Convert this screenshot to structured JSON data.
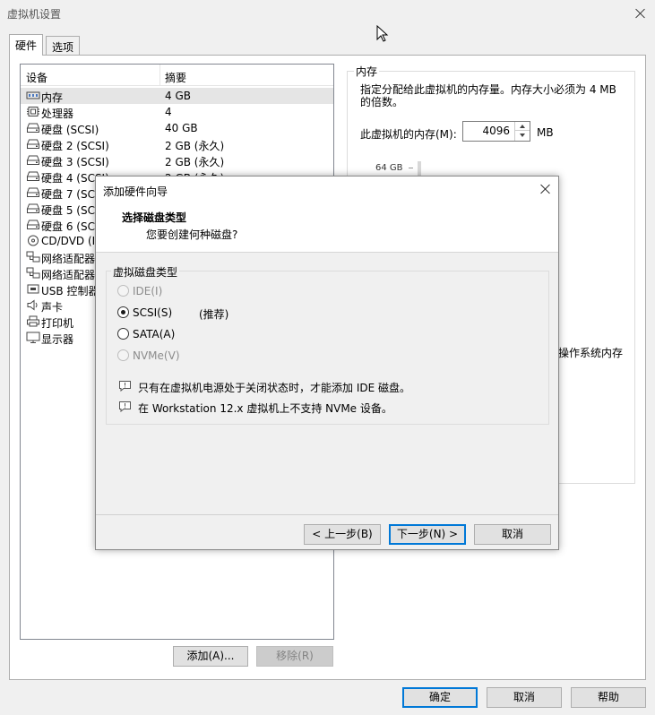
{
  "window": {
    "title": "虚拟机设置"
  },
  "tabs": [
    {
      "label": "硬件"
    },
    {
      "label": "选项"
    }
  ],
  "device_list": {
    "columns": [
      "设备",
      "摘要"
    ],
    "rows": [
      {
        "name": "内存",
        "summary": "4 GB",
        "icon": "memory-icon"
      },
      {
        "name": "处理器",
        "summary": "4",
        "icon": "processor-icon"
      },
      {
        "name": "硬盘 (SCSI)",
        "summary": "40 GB",
        "icon": "harddisk-icon"
      },
      {
        "name": "硬盘 2 (SCSI)",
        "summary": "2 GB (永久)",
        "icon": "harddisk-icon"
      },
      {
        "name": "硬盘 3 (SCSI)",
        "summary": "2 GB (永久)",
        "icon": "harddisk-icon"
      },
      {
        "name": "硬盘 4 (SCSI)",
        "summary": "2 GB (永久)",
        "icon": "harddisk-icon"
      },
      {
        "name": "硬盘 7 (SCSI)",
        "summary": "",
        "icon": "harddisk-icon"
      },
      {
        "name": "硬盘 5 (SCSI)",
        "summary": "",
        "icon": "harddisk-icon"
      },
      {
        "name": "硬盘 6 (SCSI)",
        "summary": "",
        "icon": "harddisk-icon"
      },
      {
        "name": "CD/DVD (IDE)",
        "summary": "",
        "icon": "cdrom-icon"
      },
      {
        "name": "网络适配器",
        "summary": "",
        "icon": "network-icon"
      },
      {
        "name": "网络适配器",
        "summary": "",
        "icon": "network-icon"
      },
      {
        "name": "USB 控制器",
        "summary": "",
        "icon": "usb-icon"
      },
      {
        "name": "声卡",
        "summary": "",
        "icon": "sound-icon"
      },
      {
        "name": "打印机",
        "summary": "",
        "icon": "printer-icon"
      },
      {
        "name": "显示器",
        "summary": "",
        "icon": "display-icon"
      }
    ],
    "add_button": "添加(A)...",
    "remove_button": "移除(R)"
  },
  "memory": {
    "group_title": "内存",
    "description": "指定分配给此虚拟机的内存量。内存大小必须为 4 MB 的倍数。",
    "label": "此虚拟机的内存(M):",
    "value": "4096",
    "unit": "MB",
    "scale_top": "64 GB",
    "partial_text": "操作系统内存"
  },
  "wizard": {
    "title": "添加硬件向导",
    "heading": "选择磁盘类型",
    "subheading": "您要创建何种磁盘?",
    "group_title": "虚拟磁盘类型",
    "options": [
      {
        "label": "IDE(I)",
        "checked": false,
        "enabled": false,
        "note": ""
      },
      {
        "label": "SCSI(S)",
        "checked": true,
        "enabled": true,
        "note": "(推荐)"
      },
      {
        "label": "SATA(A)",
        "checked": false,
        "enabled": true,
        "note": ""
      },
      {
        "label": "NVMe(V)",
        "checked": false,
        "enabled": false,
        "note": ""
      }
    ],
    "notes": [
      "只有在虚拟机电源处于关闭状态时，才能添加 IDE 磁盘。",
      "在 Workstation 12.x 虚拟机上不支持 NVMe 设备。"
    ],
    "back_button": "< 上一步(B)",
    "next_button": "下一步(N) >",
    "cancel_button": "取消"
  },
  "footer": {
    "ok": "确定",
    "cancel": "取消",
    "help": "帮助"
  }
}
